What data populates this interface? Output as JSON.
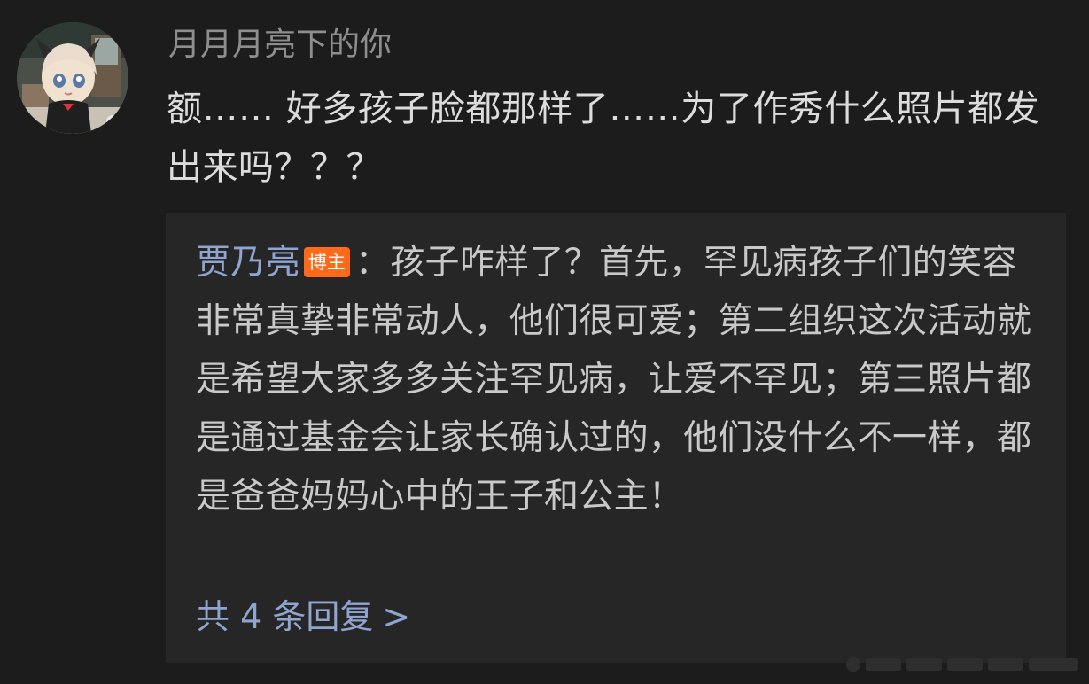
{
  "comment": {
    "username": "月月月亮下的你",
    "text": "额…… 好多孩子脸都那样了……为了作秀什么照片都发出来吗？？？"
  },
  "reply": {
    "author": "贾乃亮",
    "badge": "博主",
    "text": "：孩子咋样了？首先，罕见病孩子们的笑容非常真挚非常动人，他们很可爱；第二组织这次活动就是希望大家多多关注罕见病，让爱不罕见；第三照片都是通过基金会让家长确认过的，他们没什么不一样，都是爸爸妈妈心中的王子和公主！",
    "more_label": "共 4 条回复",
    "more_chevron": ">"
  },
  "icons": {
    "avatar": "avatar-illustration",
    "more": "chevron-right-icon"
  },
  "colors": {
    "background": "#1c1c1c",
    "reply_background": "#262626",
    "link": "#8fa4cf",
    "badge": "#ff6a1a",
    "text": "#dcdcdc"
  }
}
